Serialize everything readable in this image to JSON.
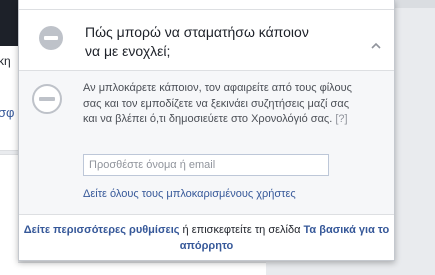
{
  "background": {
    "left_text_1": "κη",
    "left_text_2": "σφ"
  },
  "privacy_shortcut": {
    "question": "Πώς μπορώ να σταματήσω κάποιον να με ενοχλεί;",
    "description": "Αν μπλοκάρετε κάποιον, τον αφαιρείτε από τους φίλους σας και τον εμποδίζετε να ξεκινάει συζητήσεις μαζί σας και να βλέπει ό,τι δημοσιεύετε στο Χρονολόγιό σας.",
    "help_marker": "[?]",
    "input_placeholder": "Προσθέστε όνομα ή email",
    "input_value": "",
    "see_all_blocked_link": "Δείτε όλους τους μπλοκαρισμένους χρήστες",
    "icon": "minus-circle-icon",
    "chevron_icon": "chevron-up-icon"
  },
  "footer": {
    "more_settings_link": "Δείτε περισσότερες ρυθμίσεις",
    "connector_text": " ή επισκεφτείτε τη σελίδα ",
    "privacy_basics_link": "Τα βασικά για το απόρρητο"
  },
  "colors": {
    "link": "#365899",
    "text": "#1d2129",
    "muted": "#90949c",
    "panel_bg": "#f6f7f9"
  }
}
